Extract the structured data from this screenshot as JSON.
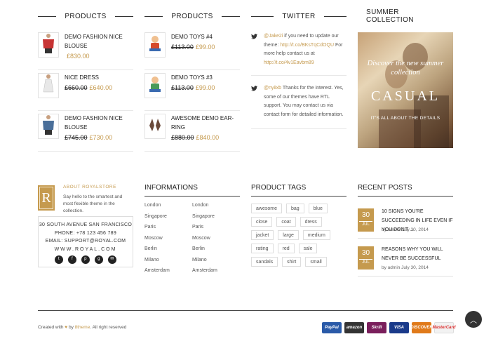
{
  "columns": {
    "products1": {
      "title": "PRODUCTS",
      "items": [
        {
          "name": "DEMO FASHION NICE BLOUSE",
          "old_price": "",
          "price": "£830.00",
          "icon": "red-shirt-icon",
          "color": "#c73434"
        },
        {
          "name": "NICE DRESS",
          "old_price": "£660.00",
          "price": "£640.00",
          "icon": "white-dress-icon",
          "color": "#e8e8e8"
        },
        {
          "name": "DEMO FASHION NICE BLOUSE",
          "old_price": "£745.00",
          "price": "£730.00",
          "icon": "denim-jacket-icon",
          "color": "#4a6f9a"
        }
      ]
    },
    "products2": {
      "title": "PRODUCTS",
      "items": [
        {
          "name": "DEMO TOYS #4",
          "old_price": "£113.00",
          "price": "£99.00",
          "icon": "toy-icon",
          "color": "#d64a2a"
        },
        {
          "name": "DEMO TOYS #3",
          "old_price": "£113.00",
          "price": "£99.00",
          "icon": "toy-icon",
          "color": "#4a9a5a"
        },
        {
          "name": "AWESOME DEMO EAR-RING",
          "old_price": "£880.00",
          "price": "£840.00",
          "icon": "earring-icon",
          "color": "#6a4a3a"
        }
      ]
    },
    "twitter": {
      "title": "TWITTER",
      "tweets": [
        {
          "handle": "@Jake2i",
          "text": " if you need to update our theme: ",
          "link": "http://t.co/BKsTqCdOQU",
          "text2": " For more help contact us at ",
          "link2": "http://t.co/4v1Eavbm89"
        },
        {
          "handle": "@nyiixb",
          "text": " Thanks for the interest. Yes, some of our themes have RTL support. You may contact us via contact form for detailed information.",
          "link": "",
          "text2": "",
          "link2": ""
        }
      ]
    },
    "summer": {
      "title": "SUMMER COLLECTION",
      "banner_line1": "Discover the new summer collection",
      "banner_line2": "CASUAL",
      "banner_line3": "IT'S ALL ABOUT THE DETAILS"
    }
  },
  "footer": {
    "about": {
      "logo_letter": "R",
      "title": "ABOUT ROYALSTORE",
      "text": "Say hello to the smartest and most flexible theme in the collection.",
      "address": "30 SOUTH AVENUE SAN FRANCISCO",
      "phone_label": "PHONE: ",
      "phone": "+78 123 456 789",
      "email_label": "EMAIL: ",
      "email": "SUPPORT@ROYAL.COM",
      "website": "WWW.ROYAL.COM",
      "social_icons": [
        "twitter-icon",
        "facebook-icon",
        "pinterest-icon",
        "google-plus-icon",
        "email-icon"
      ]
    },
    "informations": {
      "title": "INFORMATIONS",
      "left": [
        "London",
        "Singapore",
        "Paris",
        "Moscow",
        "Berlin",
        "Milano",
        "Amsterdam"
      ],
      "right": [
        "London",
        "Singapore",
        "Paris",
        "Moscow",
        "Berlin",
        "Milano",
        "Amsterdam"
      ]
    },
    "product_tags": {
      "title": "PRODUCT TAGS",
      "tags": [
        "awesome",
        "bag",
        "blue",
        "close",
        "coat",
        "dress",
        "jacket",
        "large",
        "medium",
        "rating",
        "red",
        "sale",
        "sandals",
        "shirt",
        "small"
      ]
    },
    "recent_posts": {
      "title": "RECENT POSTS",
      "posts": [
        {
          "day": "30",
          "month": "JUL",
          "title": "10 SIGNS YOU'RE SUCCEEDING IN LIFE EVEN IF YOU DON'T ...",
          "meta": "by admin July 30, 2014"
        },
        {
          "day": "30",
          "month": "JUL",
          "title": "REASONS WHY YOU WILL NEVER BE SUCCESSFUL",
          "meta": "by admin July 30, 2014"
        }
      ]
    }
  },
  "bottom": {
    "copy_prefix": "Created with ",
    "copy_by": " by ",
    "copy_brand": "8theme",
    "copy_suffix": ". All right reserved",
    "payments": [
      {
        "name": "PayPal",
        "color": "#2a5aa8"
      },
      {
        "name": "amazon",
        "color": "#333333"
      },
      {
        "name": "Skrill",
        "color": "#7a1f5c"
      },
      {
        "name": "VISA",
        "color": "#1a3a8a"
      },
      {
        "name": "DISCOVER",
        "color": "#e07a1a"
      },
      {
        "name": "MasterCard",
        "color": "#f2f2f2"
      }
    ]
  },
  "colors": {
    "accent": "#c59a4e"
  }
}
